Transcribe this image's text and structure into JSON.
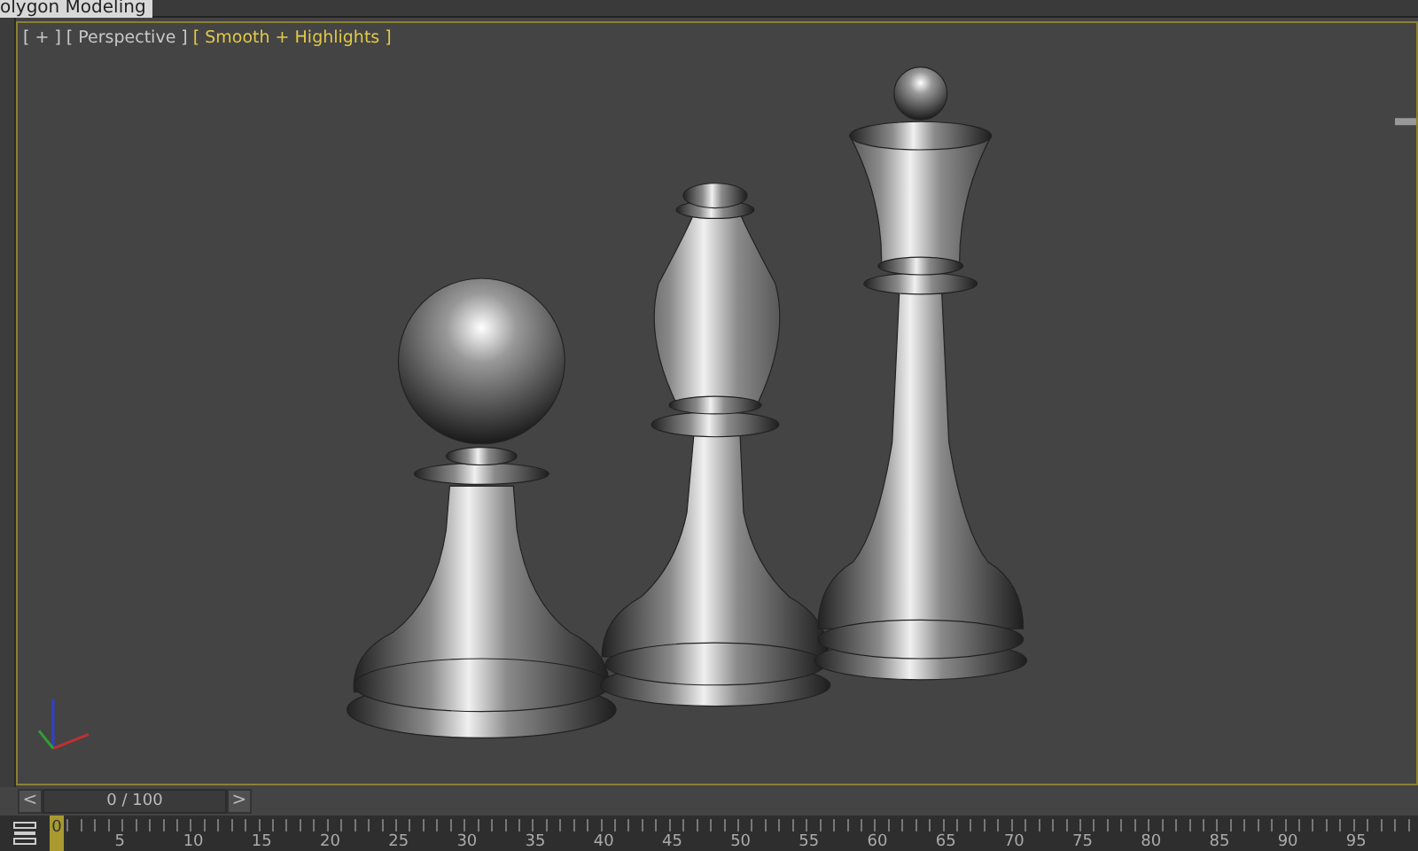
{
  "title_tab": {
    "label": "olygon Modeling"
  },
  "viewport": {
    "labels": [
      {
        "text": "[ + ]",
        "kind": "plain"
      },
      {
        "text": "[ Perspective ]",
        "kind": "plain"
      },
      {
        "text": "[ Smooth + Highlights ]",
        "kind": "shading"
      }
    ]
  },
  "time_slider": {
    "prev": "<",
    "value": "0 / 100",
    "next": ">"
  },
  "ruler": {
    "labels": [
      {
        "label": "0",
        "selected": true
      },
      {
        "label": "5",
        "selected": false
      },
      {
        "label": "10",
        "selected": false
      },
      {
        "label": "15",
        "selected": false
      },
      {
        "label": "20",
        "selected": false
      },
      {
        "label": "25",
        "selected": false
      },
      {
        "label": "30",
        "selected": false
      },
      {
        "label": "35",
        "selected": false
      },
      {
        "label": "40",
        "selected": false
      },
      {
        "label": "45",
        "selected": false
      },
      {
        "label": "50",
        "selected": false
      },
      {
        "label": "55",
        "selected": false
      },
      {
        "label": "60",
        "selected": false
      },
      {
        "label": "65",
        "selected": false
      },
      {
        "label": "70",
        "selected": false
      },
      {
        "label": "75",
        "selected": false
      },
      {
        "label": "80",
        "selected": false
      },
      {
        "label": "85",
        "selected": false
      },
      {
        "label": "90",
        "selected": false
      },
      {
        "label": "95",
        "selected": false
      }
    ]
  }
}
